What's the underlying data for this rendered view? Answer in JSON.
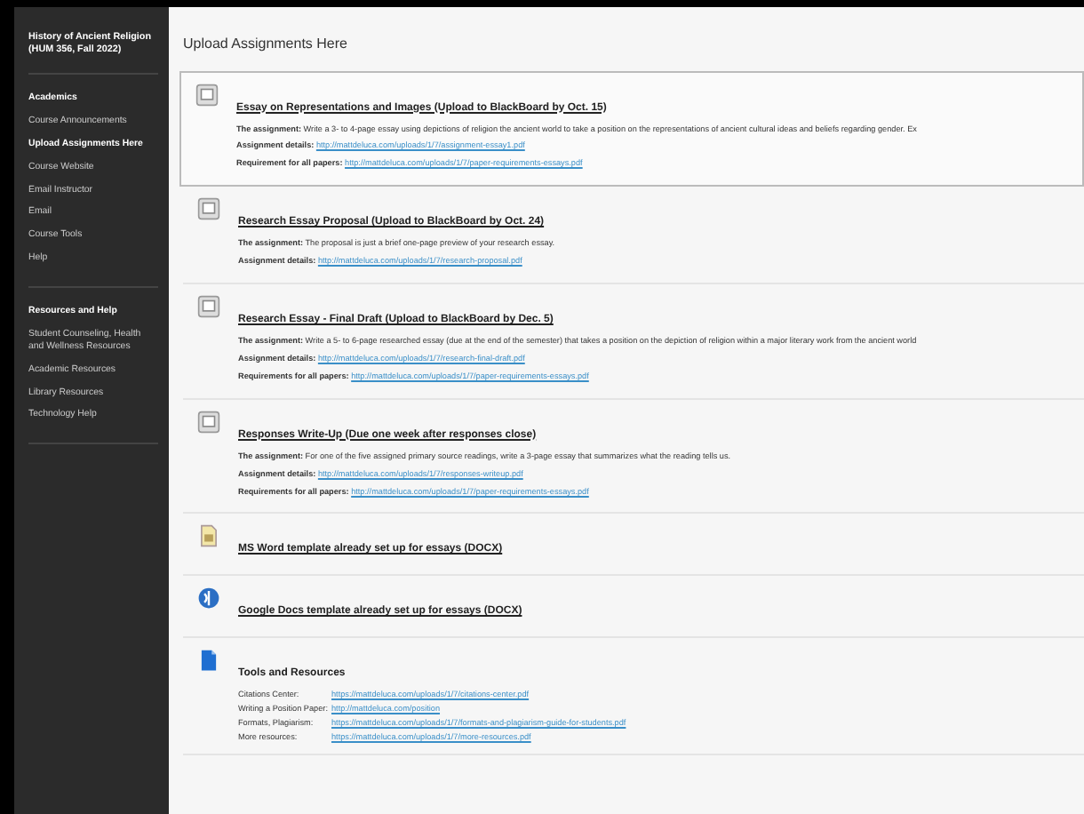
{
  "course_title": "History of Ancient Religion (HUM 356, Fall 2022)",
  "sidebar": [
    {
      "heading": "Academics",
      "items": [
        {
          "label": "Course Announcements",
          "selected": false
        },
        {
          "label": "Upload Assignments Here",
          "selected": true
        },
        {
          "label": "Course Website",
          "selected": false
        },
        {
          "label": "Email Instructor",
          "selected": false
        },
        {
          "label": "Email",
          "selected": false
        },
        {
          "label": "Course Tools",
          "selected": false
        },
        {
          "label": "Help",
          "selected": false
        }
      ]
    },
    {
      "heading": "Resources and Help",
      "items": [
        {
          "label": "Student Counseling, Health and Wellness Resources",
          "selected": false
        },
        {
          "label": "Academic Resources",
          "selected": false
        },
        {
          "label": "Library Resources",
          "selected": false
        },
        {
          "label": "Technology Help",
          "selected": false
        }
      ]
    }
  ],
  "page_title": "Upload Assignments Here",
  "items": [
    {
      "kind": "assignment",
      "highlighted": true,
      "title": "Essay on Representations and Images (Upload to BlackBoard by Oct. 15)",
      "details": [
        {
          "label": "The assignment:",
          "text": "Write a 3- to 4-page essay using depictions of religion the ancient world to take a position on the representations of ancient cultural ideas and beliefs regarding gender. Ex"
        },
        {
          "label": "Assignment details:",
          "link": "http://mattdeluca.com/uploads/1/7/assignment-essay1.pdf"
        },
        {
          "label": "Requirement for all papers:",
          "link": "http://mattdeluca.com/uploads/1/7/paper-requirements-essays.pdf"
        }
      ]
    },
    {
      "kind": "assignment",
      "highlighted": false,
      "title": "Research Essay Proposal (Upload to BlackBoard by Oct. 24)",
      "details": [
        {
          "label": "The assignment:",
          "text": "The proposal is just a brief one-page preview of your research essay."
        },
        {
          "label": "Assignment details:",
          "link": "http://mattdeluca.com/uploads/1/7/research-proposal.pdf"
        }
      ]
    },
    {
      "kind": "assignment",
      "highlighted": false,
      "title": "Research Essay - Final Draft (Upload to BlackBoard by Dec. 5)",
      "details": [
        {
          "label": "The assignment:",
          "text": "Write a 5- to 6-page researched essay (due at the end of the semester) that takes a position on the depiction of religion within a major literary work from the ancient world"
        },
        {
          "label": "Assignment details:",
          "link": "http://mattdeluca.com/uploads/1/7/research-final-draft.pdf"
        },
        {
          "label": "Requirements for all papers:",
          "link": "http://mattdeluca.com/uploads/1/7/paper-requirements-essays.pdf"
        }
      ]
    },
    {
      "kind": "assignment",
      "highlighted": false,
      "title": "Responses Write-Up (Due one week after responses close)",
      "details": [
        {
          "label": "The assignment:",
          "text": "For one of the five assigned primary source readings, write a 3-page essay that summarizes what the reading tells us."
        },
        {
          "label": "Assignment details:",
          "link": "http://mattdeluca.com/uploads/1/7/responses-writeup.pdf"
        },
        {
          "label": "Requirements for all papers:",
          "link": "http://mattdeluca.com/uploads/1/7/paper-requirements-essays.pdf"
        }
      ]
    },
    {
      "kind": "word",
      "highlighted": false,
      "title": "MS Word template already set up for essays (DOCX)"
    },
    {
      "kind": "web",
      "highlighted": false,
      "title": "Google Docs template already set up for essays (DOCX)"
    },
    {
      "kind": "resources",
      "highlighted": false,
      "title": "Tools and Resources",
      "resources": [
        {
          "label": "Citations Center:",
          "link": "https://mattdeluca.com/uploads/1/7/citations-center.pdf"
        },
        {
          "label": "Writing a Position Paper:",
          "link": "http://mattdeluca.com/position"
        },
        {
          "label": "Formats, Plagiarism:",
          "link": "https://mattdeluca.com/uploads/1/7/formats-and-plagiarism-guide-for-students.pdf"
        },
        {
          "label": "More resources:",
          "link": "https://mattdeluca.com/uploads/1/7/more-resources.pdf"
        }
      ]
    }
  ]
}
